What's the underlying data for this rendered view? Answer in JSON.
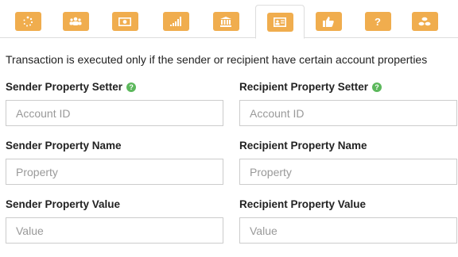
{
  "tabs": [
    {
      "icon": "spinner-icon",
      "label": ""
    },
    {
      "icon": "users-icon",
      "label": ""
    },
    {
      "icon": "money-icon",
      "label": ""
    },
    {
      "icon": "signal-icon",
      "label": ""
    },
    {
      "icon": "bank-icon",
      "label": ""
    },
    {
      "icon": "id-card-icon",
      "label": "",
      "active": true
    },
    {
      "icon": "thumbs-up-icon",
      "label": ""
    },
    {
      "icon": "question-icon",
      "label": "?"
    },
    {
      "icon": "coins-icon",
      "label": ""
    }
  ],
  "colors": {
    "tab_button": "#f0ad4e",
    "help_icon": "#5cb85c",
    "border": "#cccccc"
  },
  "description": "Transaction is executed only if the sender or recipient have certain account properties",
  "sender": {
    "setter_label": "Sender Property Setter",
    "setter_placeholder": "Account ID",
    "name_label": "Sender Property Name",
    "name_placeholder": "Property",
    "value_label": "Sender Property Value",
    "value_placeholder": "Value"
  },
  "recipient": {
    "setter_label": "Recipient Property Setter",
    "setter_placeholder": "Account ID",
    "name_label": "Recipient Property Name",
    "name_placeholder": "Property",
    "value_label": "Recipient Property Value",
    "value_placeholder": "Value"
  },
  "help_glyph": "?"
}
